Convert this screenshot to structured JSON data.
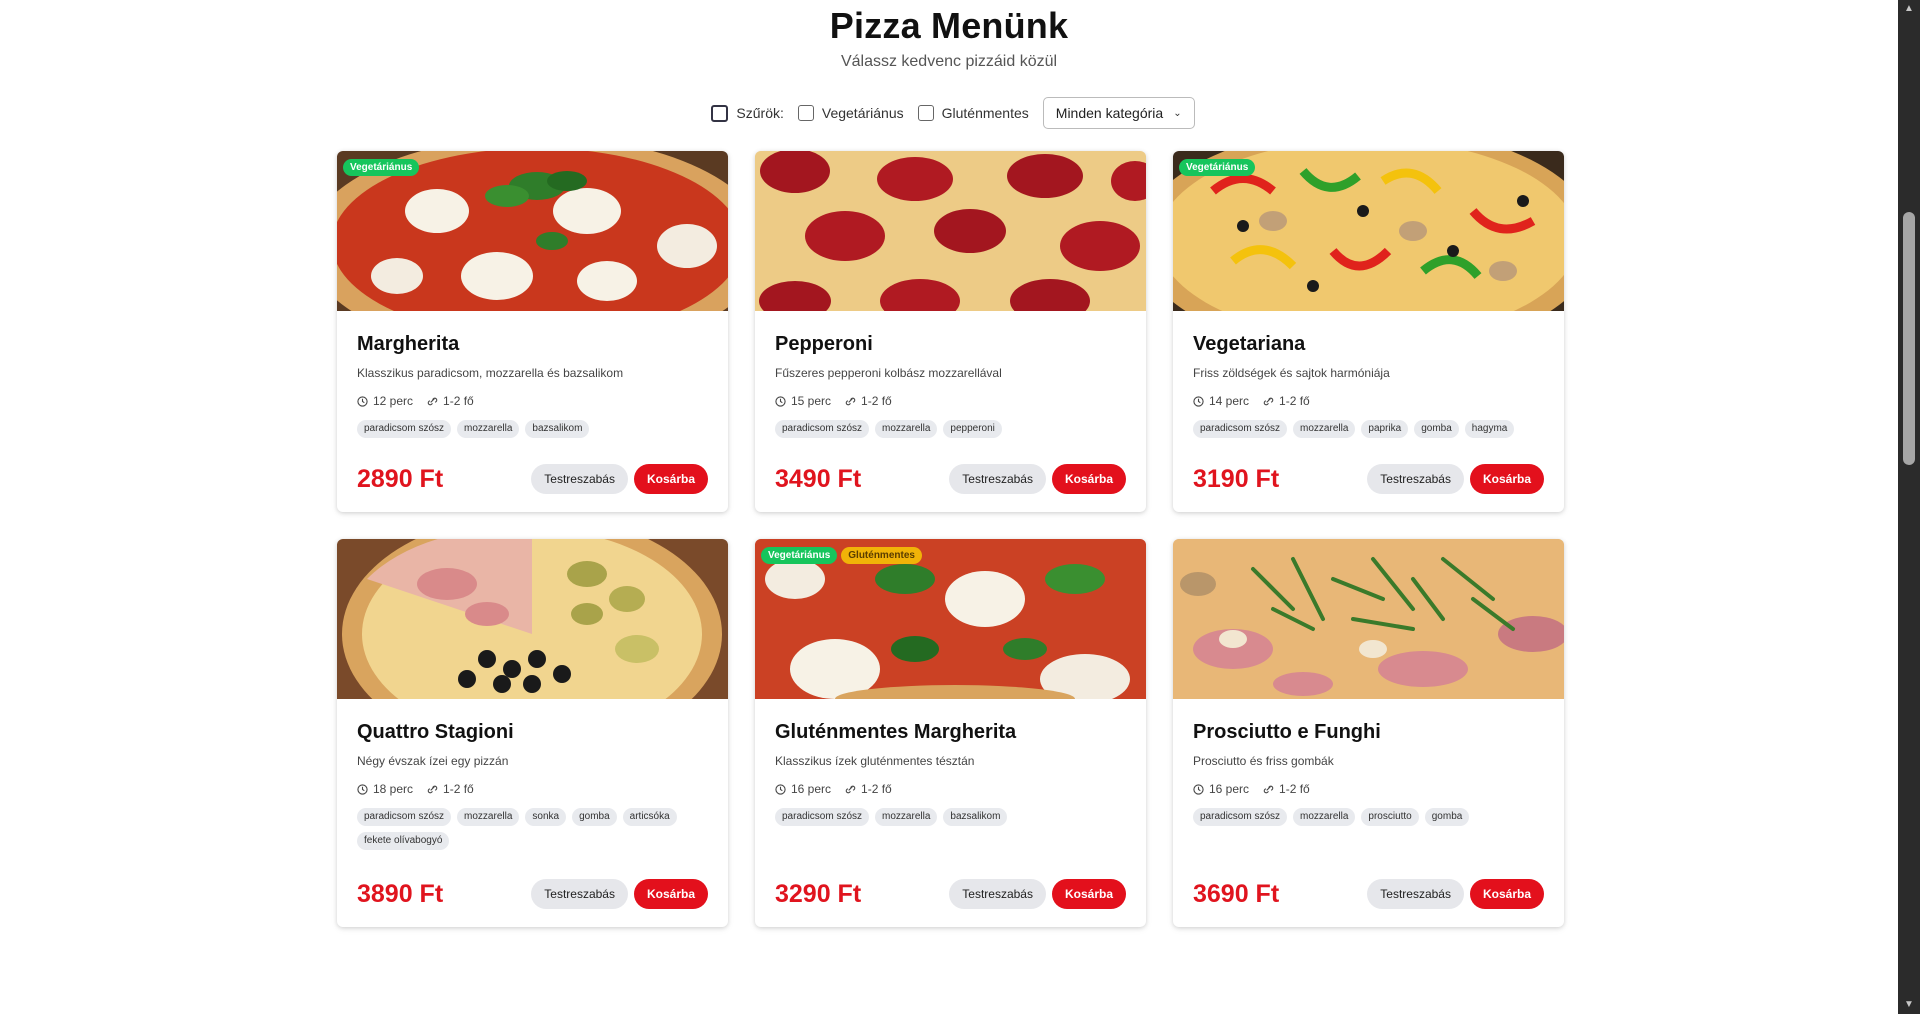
{
  "header": {
    "title": "Pizza Menünk",
    "subtitle": "Válassz kedvenc pizzáid közül"
  },
  "filters": {
    "label": "Szűrök:",
    "vegetarian": "Vegetáriánus",
    "glutenfree": "Gluténmentes",
    "category_selected": "Minden kategória"
  },
  "buttons": {
    "customize": "Testreszabás",
    "cart": "Kosárba"
  },
  "badges": {
    "vegetarian": "Vegetáriánus",
    "glutenfree": "Gluténmentes"
  },
  "colors": {
    "price": "#e0141e",
    "cart_button": "#e3101c",
    "veg_badge": "#16c55c",
    "gf_badge": "#f1b308"
  },
  "pizzas": [
    {
      "name": "Margherita",
      "description": "Klasszikus paradicsom, mozzarella és bazsalikom",
      "time": "12 perc",
      "serves": "1-2 fő",
      "tags": [
        "paradicsom szósz",
        "mozzarella",
        "bazsalikom"
      ],
      "price": "2890 Ft",
      "vegetarian": true,
      "glutenfree": false
    },
    {
      "name": "Pepperoni",
      "description": "Fűszeres pepperoni kolbász mozzarellával",
      "time": "15 perc",
      "serves": "1-2 fő",
      "tags": [
        "paradicsom szósz",
        "mozzarella",
        "pepperoni"
      ],
      "price": "3490 Ft",
      "vegetarian": false,
      "glutenfree": false
    },
    {
      "name": "Vegetariana",
      "description": "Friss zöldségek és sajtok harmóniája",
      "time": "14 perc",
      "serves": "1-2 fő",
      "tags": [
        "paradicsom szósz",
        "mozzarella",
        "paprika",
        "gomba",
        "hagyma"
      ],
      "price": "3190 Ft",
      "vegetarian": true,
      "glutenfree": false
    },
    {
      "name": "Quattro Stagioni",
      "description": "Négy évszak ízei egy pizzán",
      "time": "18 perc",
      "serves": "1-2 fő",
      "tags": [
        "paradicsom szósz",
        "mozzarella",
        "sonka",
        "gomba",
        "articsóka",
        "fekete olívabogyó"
      ],
      "price": "3890 Ft",
      "vegetarian": false,
      "glutenfree": false
    },
    {
      "name": "Gluténmentes Margherita",
      "description": "Klasszikus ízek gluténmentes tésztán",
      "time": "16 perc",
      "serves": "1-2 fő",
      "tags": [
        "paradicsom szósz",
        "mozzarella",
        "bazsalikom"
      ],
      "price": "3290 Ft",
      "vegetarian": true,
      "glutenfree": true
    },
    {
      "name": "Prosciutto e Funghi",
      "description": "Prosciutto és friss gombák",
      "time": "16 perc",
      "serves": "1-2 fő",
      "tags": [
        "paradicsom szósz",
        "mozzarella",
        "prosciutto",
        "gomba"
      ],
      "price": "3690 Ft",
      "vegetarian": false,
      "glutenfree": false
    }
  ]
}
